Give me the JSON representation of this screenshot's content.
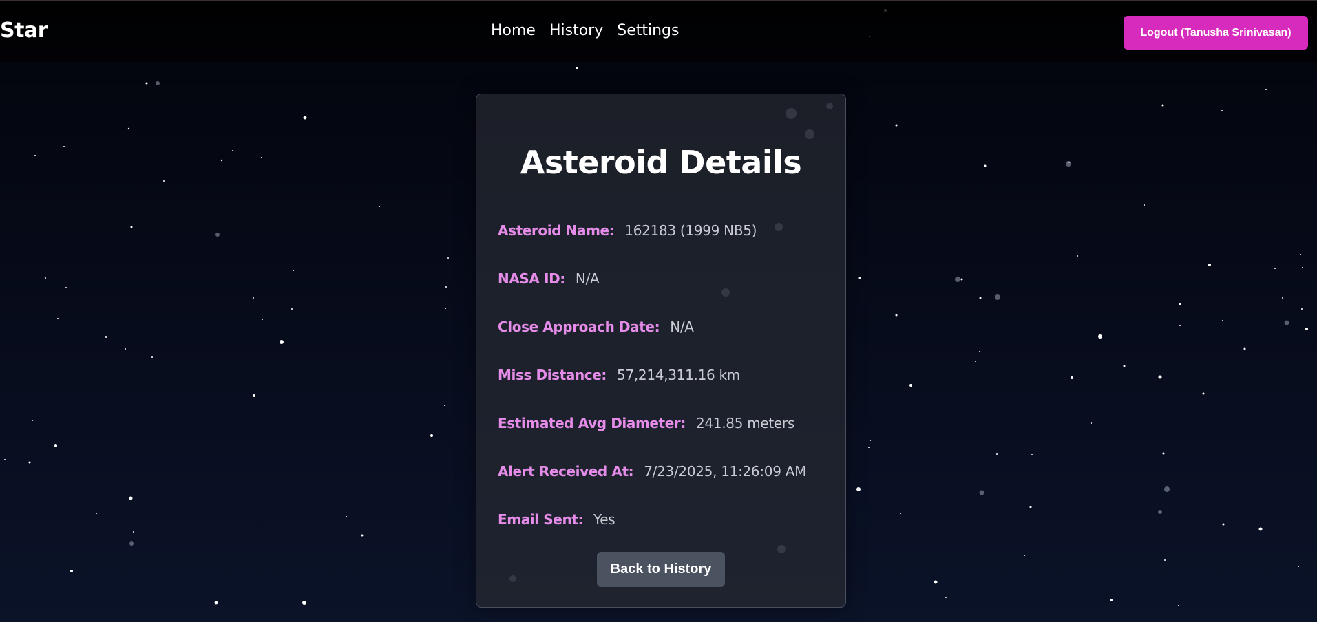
{
  "nav": {
    "brand": "Star",
    "links": [
      "Home",
      "History",
      "Settings"
    ],
    "logout_label": "Logout (Tanusha Srinivasan)"
  },
  "card": {
    "title": "Asteroid Details",
    "details": [
      {
        "label": "Asteroid Name:",
        "value": "162183 (1999 NB5)"
      },
      {
        "label": "NASA ID:",
        "value": "N/A"
      },
      {
        "label": "Close Approach Date:",
        "value": "N/A"
      },
      {
        "label": "Miss Distance:",
        "value": "57,214,311.16 km"
      },
      {
        "label": "Estimated Avg Diameter:",
        "value": "241.85 meters"
      },
      {
        "label": "Alert Received At:",
        "value": "7/23/2025, 11:26:09 AM"
      },
      {
        "label": "Email Sent:",
        "value": "Yes"
      }
    ],
    "back_label": "Back to History"
  },
  "colors": {
    "accent_pink": "#d62bbd",
    "label_pink": "#e58ce8",
    "button_gray": "#4b5260"
  }
}
